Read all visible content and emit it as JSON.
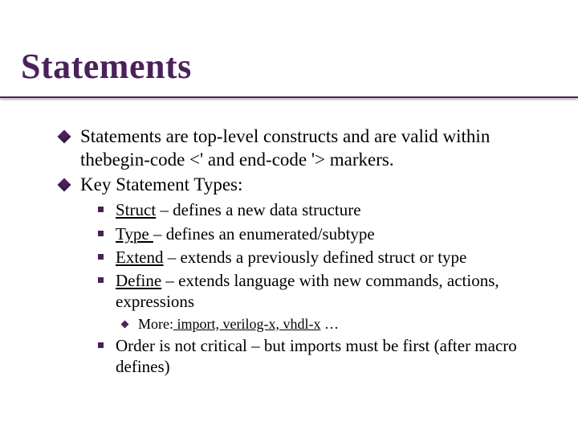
{
  "title": "Statements",
  "bullets": {
    "b0": "Statements are top-level constructs and are valid within thebegin-code <' and end-code '> markers.",
    "b1": "Key Statement Types:"
  },
  "types": {
    "t0": {
      "term": "Struct",
      "rest": " – defines a new data structure"
    },
    "t1": {
      "term": "Type ",
      "rest": "– defines an enumerated/subtype"
    },
    "t2": {
      "term": "Extend",
      "rest": " – extends a previously defined struct or type"
    },
    "t3": {
      "term": "Define",
      "rest": " – extends language with new commands, actions, expressions"
    }
  },
  "more": {
    "label": "More:",
    "list": " import, verilog-x, vhdl-x",
    "tail": " …"
  },
  "order": "Order is not critical – but imports must be first (after macro defines)"
}
